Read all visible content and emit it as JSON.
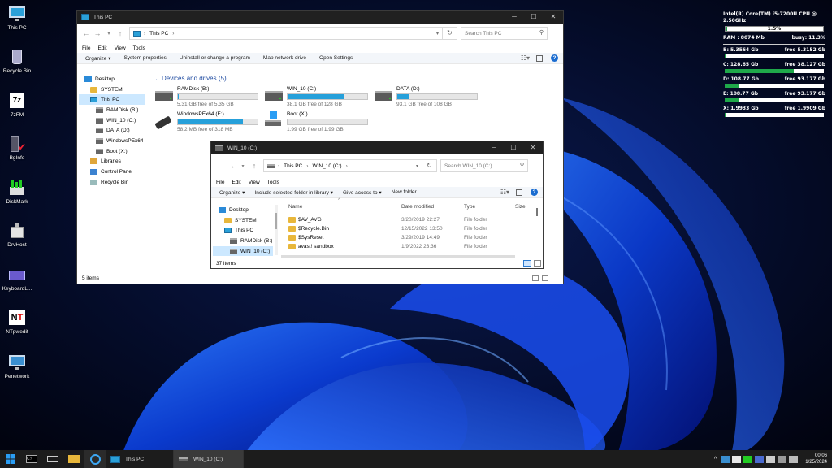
{
  "desktop": {
    "icons": [
      {
        "label": "This PC",
        "icon": "this-pc-icon"
      },
      {
        "label": "Recycle Bin",
        "icon": "recycle-bin-icon"
      },
      {
        "label": "7zFM",
        "icon": "7zip-icon"
      },
      {
        "label": "BgInfo",
        "icon": "bginfo-icon"
      },
      {
        "label": "DiskMark",
        "icon": "diskmark-icon"
      },
      {
        "label": "DrvHost",
        "icon": "drvhost-icon"
      },
      {
        "label": "KeyboardL...",
        "icon": "keyboard-icon"
      },
      {
        "label": "NTpwedit",
        "icon": "ntpwedit-icon"
      },
      {
        "label": "Penetwork",
        "icon": "penetwork-icon"
      }
    ]
  },
  "gadget": {
    "cpu_name": "Intel(R) Core(TM) i5-7200U CPU @ 2.50GHz",
    "cpu_load": "1.5%",
    "ram": "RAM : 8074 Mb",
    "busy": "busy: 11.3%",
    "drives": [
      {
        "label": "B: 5.3564  Gb",
        "free": "free 5.3152  Gb",
        "used_fraction": 0.01
      },
      {
        "label": "C: 128.65  Gb",
        "free": "free 38.127  Gb",
        "used_fraction": 0.7
      },
      {
        "label": "D: 108.77  Gb",
        "free": "free 93.177  Gb",
        "used_fraction": 0.14
      },
      {
        "label": "E: 108.77  Gb",
        "free": "free 93.177  Gb",
        "used_fraction": 0.14
      },
      {
        "label": "X: 1.9933  Gb",
        "free": "free 1.9909  Gb",
        "used_fraction": 0.01
      }
    ],
    "bar_color": "#1fa84a"
  },
  "win_thispc": {
    "title": "This PC",
    "address": "This PC",
    "search_placeholder": "Search This PC",
    "menu": [
      "File",
      "Edit",
      "View",
      "Tools"
    ],
    "commands": [
      "Organize ▾",
      "System properties",
      "Uninstall or change a program",
      "Map network drive",
      "Open Settings"
    ],
    "nav": [
      {
        "label": "Desktop",
        "icon": "desk-ico",
        "indent": 1
      },
      {
        "label": "SYSTEM",
        "icon": "folder-ico",
        "indent": 2
      },
      {
        "label": "This PC",
        "icon": "pc-ico",
        "indent": 2,
        "selected": true
      },
      {
        "label": "RAMDisk (B:)",
        "icon": "drive-ico",
        "indent": 3
      },
      {
        "label": "WIN_10 (C:)",
        "icon": "drive-ico",
        "indent": 3
      },
      {
        "label": "DATA (D:)",
        "icon": "drive-ico",
        "indent": 3
      },
      {
        "label": "WindowsPEx64 (E:)",
        "icon": "drive-ico",
        "indent": 3
      },
      {
        "label": "Boot (X:)",
        "icon": "drive-ico",
        "indent": 3
      },
      {
        "label": "Libraries",
        "icon": "lib-ico",
        "indent": 2
      },
      {
        "label": "Control Panel",
        "icon": "cp-ico",
        "indent": 2
      },
      {
        "label": "Recycle Bin",
        "icon": "bin-ico",
        "indent": 2
      }
    ],
    "section": "Devices and drives (5)",
    "drives": [
      {
        "name": "RAMDisk (B:)",
        "free": "5.31 GB free of 5.35 GB",
        "used": 0.01
      },
      {
        "name": "WIN_10 (C:)",
        "free": "38.1 GB free of 128 GB",
        "used": 0.7
      },
      {
        "name": "DATA (D:)",
        "free": "93.1 GB free of 108 GB",
        "used": 0.14
      },
      {
        "name": "WindowsPEx64 (E:)",
        "free": "58.2 MB free of 318 MB",
        "used": 0.82
      },
      {
        "name": "Boot (X:)",
        "free": "1.99 GB free of 1.99 GB",
        "used": 0.0
      }
    ],
    "status": "5 items"
  },
  "win_c": {
    "title": "WIN_10 (C:)",
    "crumbs": [
      "This PC",
      "WIN_10 (C:)"
    ],
    "search_placeholder": "Search WIN_10 (C:)",
    "menu": [
      "File",
      "Edit",
      "View",
      "Tools"
    ],
    "commands": [
      "Organize ▾",
      "Include selected folder in library ▾",
      "Give access to ▾",
      "New folder"
    ],
    "nav": [
      {
        "label": "Desktop",
        "icon": "desk-ico",
        "indent": 1
      },
      {
        "label": "SYSTEM",
        "icon": "folder-ico",
        "indent": 2
      },
      {
        "label": "This PC",
        "icon": "pc-ico",
        "indent": 2
      },
      {
        "label": "RAMDisk (B:)",
        "icon": "drive-ico",
        "indent": 3
      },
      {
        "label": "WIN_10 (C:)",
        "icon": "drive-ico",
        "indent": 3,
        "selected": true
      }
    ],
    "columns": [
      "Name",
      "Date modified",
      "Type",
      "Size"
    ],
    "rows": [
      {
        "name": "$AV_AVG",
        "date": "3/20/2019 22:27",
        "type": "File folder"
      },
      {
        "name": "$Recycle.Bin",
        "date": "12/15/2022 13:50",
        "type": "File folder"
      },
      {
        "name": "$SysReset",
        "date": "3/29/2019 14:49",
        "type": "File folder"
      },
      {
        "name": "avast! sandbox",
        "date": "1/9/2022 23:36",
        "type": "File folder"
      }
    ],
    "status": "37 items"
  },
  "taskbar": {
    "tasks": [
      "This PC",
      "WIN_10 (C:)"
    ],
    "time": "00:06",
    "date": "1/25/2024"
  }
}
